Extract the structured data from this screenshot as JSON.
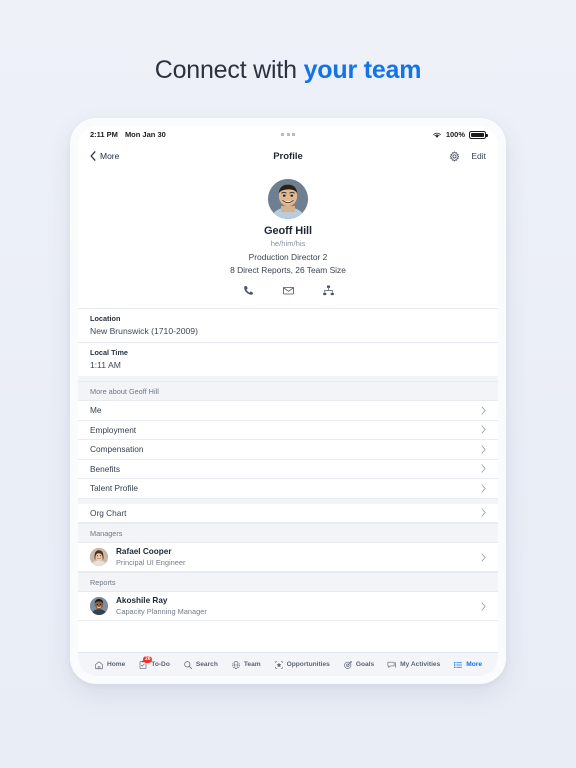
{
  "headline": {
    "lead": "Connect with ",
    "accent": "your team"
  },
  "status_bar": {
    "time": "2:11 PM",
    "date": "Mon Jan 30",
    "battery_percent": "100%",
    "wifi_icon": "wifi-icon",
    "battery_icon": "battery-full-icon",
    "multitask_dots": "multitasking-dots-icon"
  },
  "nav_bar": {
    "back_label": "More",
    "back_icon": "chevron-left-icon",
    "title": "Profile",
    "settings_icon": "gear-icon",
    "edit_label": "Edit"
  },
  "profile": {
    "avatar": "user-avatar",
    "name": "Geoff Hill",
    "pronouns": "he/him/his",
    "job_title": "Production Director 2",
    "team_summary": "8 Direct Reports, 26 Team Size",
    "actions": [
      {
        "name": "phone-icon",
        "label": "Call"
      },
      {
        "name": "envelope-icon",
        "label": "Email"
      },
      {
        "name": "org-chart-icon",
        "label": "Org Chart"
      }
    ]
  },
  "info_rows": [
    {
      "label": "Location",
      "value": "New Brunswick (1710-2009)"
    },
    {
      "label": "Local Time",
      "value": "1:11 AM"
    }
  ],
  "more_section": {
    "header": "More about Geoff Hill",
    "items": [
      {
        "label": "Me"
      },
      {
        "label": "Employment"
      },
      {
        "label": "Compensation"
      },
      {
        "label": "Benefits"
      },
      {
        "label": "Talent Profile"
      }
    ]
  },
  "org_chart_row": {
    "label": "Org Chart"
  },
  "managers": {
    "header": "Managers",
    "people": [
      {
        "name": "Rafael Cooper",
        "role": "Principal UI Engineer"
      }
    ]
  },
  "reports": {
    "header": "Reports",
    "people": [
      {
        "name": "Akoshile Ray",
        "role": "Capacity Planning Manager"
      }
    ]
  },
  "tab_bar": {
    "items": [
      {
        "label": "Home",
        "icon": "home-icon",
        "badge": "",
        "active": false
      },
      {
        "label": "To-Do",
        "icon": "todo-checklist-icon",
        "badge": "26",
        "active": false
      },
      {
        "label": "Search",
        "icon": "search-icon",
        "badge": "",
        "active": false
      },
      {
        "label": "Team",
        "icon": "team-globe-icon",
        "badge": "",
        "active": false
      },
      {
        "label": "Opportunities",
        "icon": "opportunities-star-icon",
        "badge": "",
        "active": false
      },
      {
        "label": "Goals",
        "icon": "goals-target-icon",
        "badge": "",
        "active": false
      },
      {
        "label": "My Activities",
        "icon": "activities-chat-icon",
        "badge": "",
        "active": false
      },
      {
        "label": "More",
        "icon": "more-list-icon",
        "badge": "",
        "active": true
      }
    ]
  },
  "colors": {
    "page_background": "#eef1f8",
    "accent_blue": "#1373e8",
    "badge_red": "#ef3124",
    "section_gray": "#f2f4f8",
    "chevron_gray": "#97a2b4",
    "text_primary": "#1f2733",
    "text_secondary": "#737c8b"
  }
}
